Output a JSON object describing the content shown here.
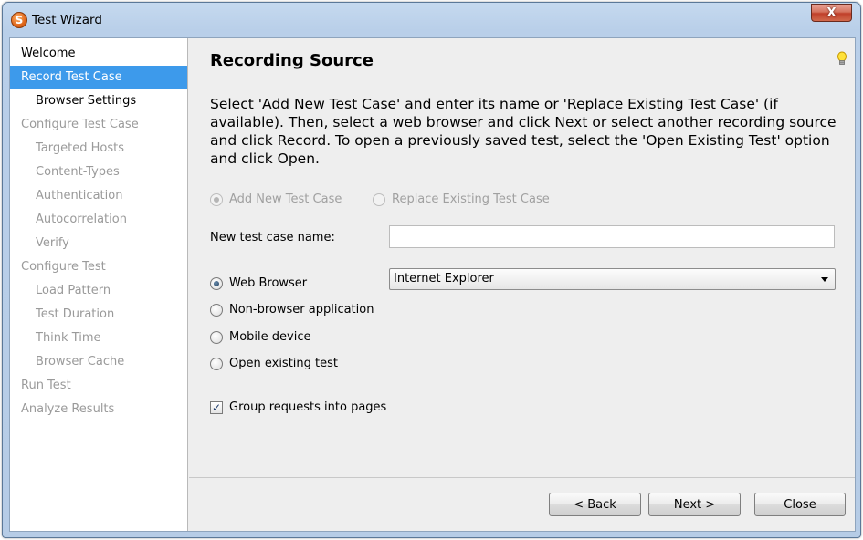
{
  "window": {
    "title": "Test Wizard",
    "close_label": "X",
    "app_icon_letter": "S"
  },
  "sidebar": {
    "items": [
      {
        "label": "Welcome",
        "level": 1,
        "state": "normal"
      },
      {
        "label": "Record Test Case",
        "level": 1,
        "state": "active"
      },
      {
        "label": "Browser Settings",
        "level": 2,
        "state": "normal"
      },
      {
        "label": "Configure Test Case",
        "level": 1,
        "state": "disabled"
      },
      {
        "label": "Targeted Hosts",
        "level": 2,
        "state": "disabled"
      },
      {
        "label": "Content-Types",
        "level": 2,
        "state": "disabled"
      },
      {
        "label": "Authentication",
        "level": 2,
        "state": "disabled"
      },
      {
        "label": "Autocorrelation",
        "level": 2,
        "state": "disabled"
      },
      {
        "label": "Verify",
        "level": 2,
        "state": "disabled"
      },
      {
        "label": "Configure Test",
        "level": 1,
        "state": "disabled"
      },
      {
        "label": "Load Pattern",
        "level": 2,
        "state": "disabled"
      },
      {
        "label": "Test Duration",
        "level": 2,
        "state": "disabled"
      },
      {
        "label": "Think Time",
        "level": 2,
        "state": "disabled"
      },
      {
        "label": "Browser Cache",
        "level": 2,
        "state": "disabled"
      },
      {
        "label": "Run Test",
        "level": 1,
        "state": "disabled"
      },
      {
        "label": "Analyze Results",
        "level": 1,
        "state": "disabled"
      }
    ]
  },
  "main": {
    "title": "Recording Source",
    "hint_icon": "lightbulb-icon",
    "description": "Select 'Add New Test Case' and enter its name or 'Replace Existing Test Case' (if available). Then, select a web browser and click Next or select another recording source and click Record. To open a previously saved test, select the 'Open Existing Test' option and click Open.",
    "mode_options": {
      "add_new": "Add New Test Case",
      "replace_existing": "Replace Existing Test Case"
    },
    "name_field": {
      "label": "New test case name:",
      "value": ""
    },
    "source_options": {
      "web_browser": "Web Browser",
      "non_browser": "Non-browser application",
      "mobile": "Mobile device",
      "open_existing": "Open existing test"
    },
    "browser_select": {
      "selected": "Internet Explorer"
    },
    "group_requests": {
      "label": "Group requests into pages",
      "checked": true
    }
  },
  "buttons": {
    "back": "< Back",
    "next": "Next >",
    "close": "Close"
  }
}
